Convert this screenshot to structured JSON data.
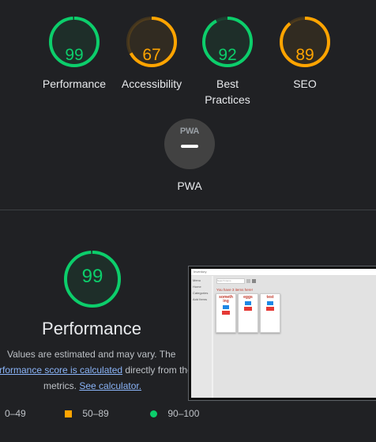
{
  "scores": [
    {
      "value": "99",
      "label": "Performance",
      "pct": 99,
      "color": "#0cce6b"
    },
    {
      "value": "67",
      "label": "Accessibility",
      "pct": 67,
      "color": "#ffa400"
    },
    {
      "value": "92",
      "label": "Best Practices",
      "pct": 92,
      "color": "#0cce6b"
    },
    {
      "value": "89",
      "label": "SEO",
      "pct": 89,
      "color": "#ffa400"
    }
  ],
  "pwa": {
    "badge": "PWA",
    "label": "PWA"
  },
  "performance": {
    "score": "99",
    "score_pct": 99,
    "title": "Performance",
    "desc_1": "Values are estimated and may vary. The",
    "desc_link": "rformance score is calculated",
    "desc_2": "directly from these",
    "desc_3": "metrics.",
    "calc_link": "See calculator."
  },
  "legend": {
    "low": "0–49",
    "mid": "50–89",
    "high": "90–100"
  },
  "screenshot": {
    "app_name": "Inventory",
    "search_placeholder": "Search items",
    "heading": "You have 3 items here!",
    "sidebar": [
      "Menu",
      "Home",
      "Categories",
      "Add Items"
    ],
    "cards": [
      "someth ing",
      "eggs",
      "test"
    ]
  },
  "colors": {
    "pass": "#0cce6b",
    "average": "#ffa400",
    "fail": "#ff4e42"
  }
}
